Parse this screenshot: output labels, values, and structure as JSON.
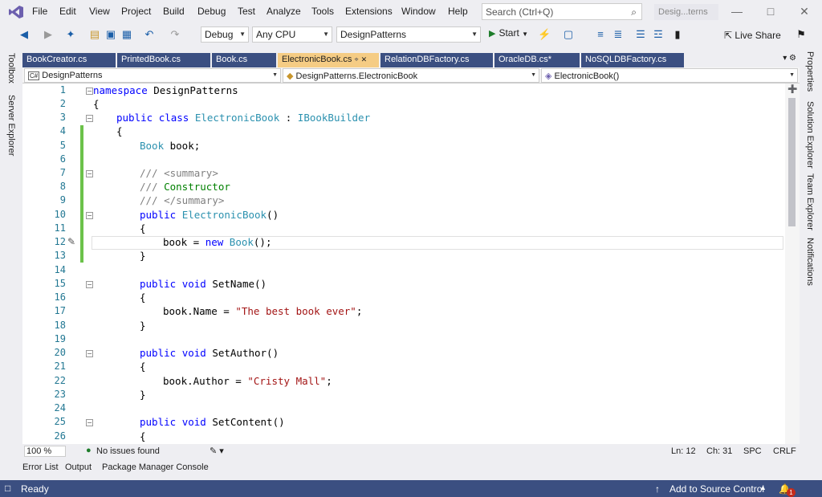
{
  "menu": {
    "items": [
      "File",
      "Edit",
      "View",
      "Project",
      "Build",
      "Debug",
      "Test",
      "Analyze",
      "Tools",
      "Extensions",
      "Window",
      "Help"
    ],
    "search_placeholder": "Search (Ctrl+Q)",
    "solution_name": "Desig...terns"
  },
  "toolbar": {
    "config": "Debug",
    "platform": "Any CPU",
    "startup_project": "DesignPatterns",
    "start_label": "Start",
    "liveshare_label": "Live Share"
  },
  "left_strip": {
    "items": [
      "Toolbox",
      "Server Explorer"
    ]
  },
  "right_strip": {
    "items": [
      "Properties",
      "Solution Explorer",
      "Team Explorer",
      "Notifications"
    ]
  },
  "tabs": [
    {
      "label": "BookCreator.cs",
      "active": false
    },
    {
      "label": "PrintedBook.cs",
      "active": false
    },
    {
      "label": "Book.cs",
      "active": false
    },
    {
      "label": "ElectronicBook.cs",
      "active": true
    },
    {
      "label": "RelationDBFactory.cs",
      "active": false
    },
    {
      "label": "OracleDB.cs*",
      "active": false
    },
    {
      "label": "NoSQLDBFactory.cs",
      "active": false
    }
  ],
  "navbar": {
    "project": "DesignPatterns",
    "class": "DesignPatterns.ElectronicBook",
    "member": "ElectronicBook()",
    "project_badge": "C#"
  },
  "code_lines": [
    {
      "n": "1"
    },
    {
      "n": "2"
    },
    {
      "n": "3"
    },
    {
      "n": "4"
    },
    {
      "n": "5"
    },
    {
      "n": "6"
    },
    {
      "n": "7"
    },
    {
      "n": "8"
    },
    {
      "n": "9"
    },
    {
      "n": "10"
    },
    {
      "n": "11"
    },
    {
      "n": "12"
    },
    {
      "n": "13"
    },
    {
      "n": "14"
    },
    {
      "n": "15"
    },
    {
      "n": "16"
    },
    {
      "n": "17"
    },
    {
      "n": "18"
    },
    {
      "n": "19"
    },
    {
      "n": "20"
    },
    {
      "n": "21"
    },
    {
      "n": "22"
    },
    {
      "n": "23"
    },
    {
      "n": "24"
    },
    {
      "n": "25"
    },
    {
      "n": "26"
    }
  ],
  "code": {
    "l1_kw": "namespace",
    "l1_rest": " DesignPatterns",
    "l2": "{",
    "l3_kw1": "public",
    "l3_kw2": "class",
    "l3_ty": "ElectronicBook",
    "l3_colon": " : ",
    "l3_iface": "IBookBuilder",
    "l4": "{",
    "l5_ty": "Book",
    "l5_rest": " book;",
    "l7_slashes": "///",
    "l7_tag": "<summary>",
    "l8_slashes": "///",
    "l8_text": " Constructor",
    "l9_slashes": "///",
    "l9_tag": "</summary>",
    "l10_kw": "public",
    "l10_ty": "ElectronicBook",
    "l10_rest": "()",
    "l11": "{",
    "l12_a": "book = ",
    "l12_kw": "new",
    "l12_ty": "Book",
    "l12_rest": "();",
    "l13": "}",
    "l15_kw1": "public",
    "l15_kw2": "void",
    "l15_rest": " SetName()",
    "l16": "{",
    "l17_a": "book.Name = ",
    "l17_str": "\"The best book ever\"",
    "l17_end": ";",
    "l18": "}",
    "l20_kw1": "public",
    "l20_kw2": "void",
    "l20_rest": " SetAuthor()",
    "l21": "{",
    "l22_a": "book.Author = ",
    "l22_str": "\"Cristy Mall\"",
    "l22_end": ";",
    "l23": "}",
    "l25_kw1": "public",
    "l25_kw2": "void",
    "l25_rest": " SetContent()",
    "l26": "{"
  },
  "editor_status": {
    "zoom": "100 %",
    "issues": "No issues found",
    "ln": "Ln: 12",
    "ch": "Ch: 31",
    "spc": "SPC",
    "crlf": "CRLF"
  },
  "bottom_tabs": [
    "Error List",
    "Output",
    "Package Manager Console"
  ],
  "statusbar": {
    "ready": "Ready",
    "source_control": "Add to Source Control",
    "notification_count": "1"
  },
  "colors": {
    "accent": "#3b4f81",
    "active_tab": "#f5cc84",
    "keyword": "#0000ff",
    "type": "#2b91af",
    "string": "#a31515",
    "changed_marker": "#6cc24a"
  }
}
